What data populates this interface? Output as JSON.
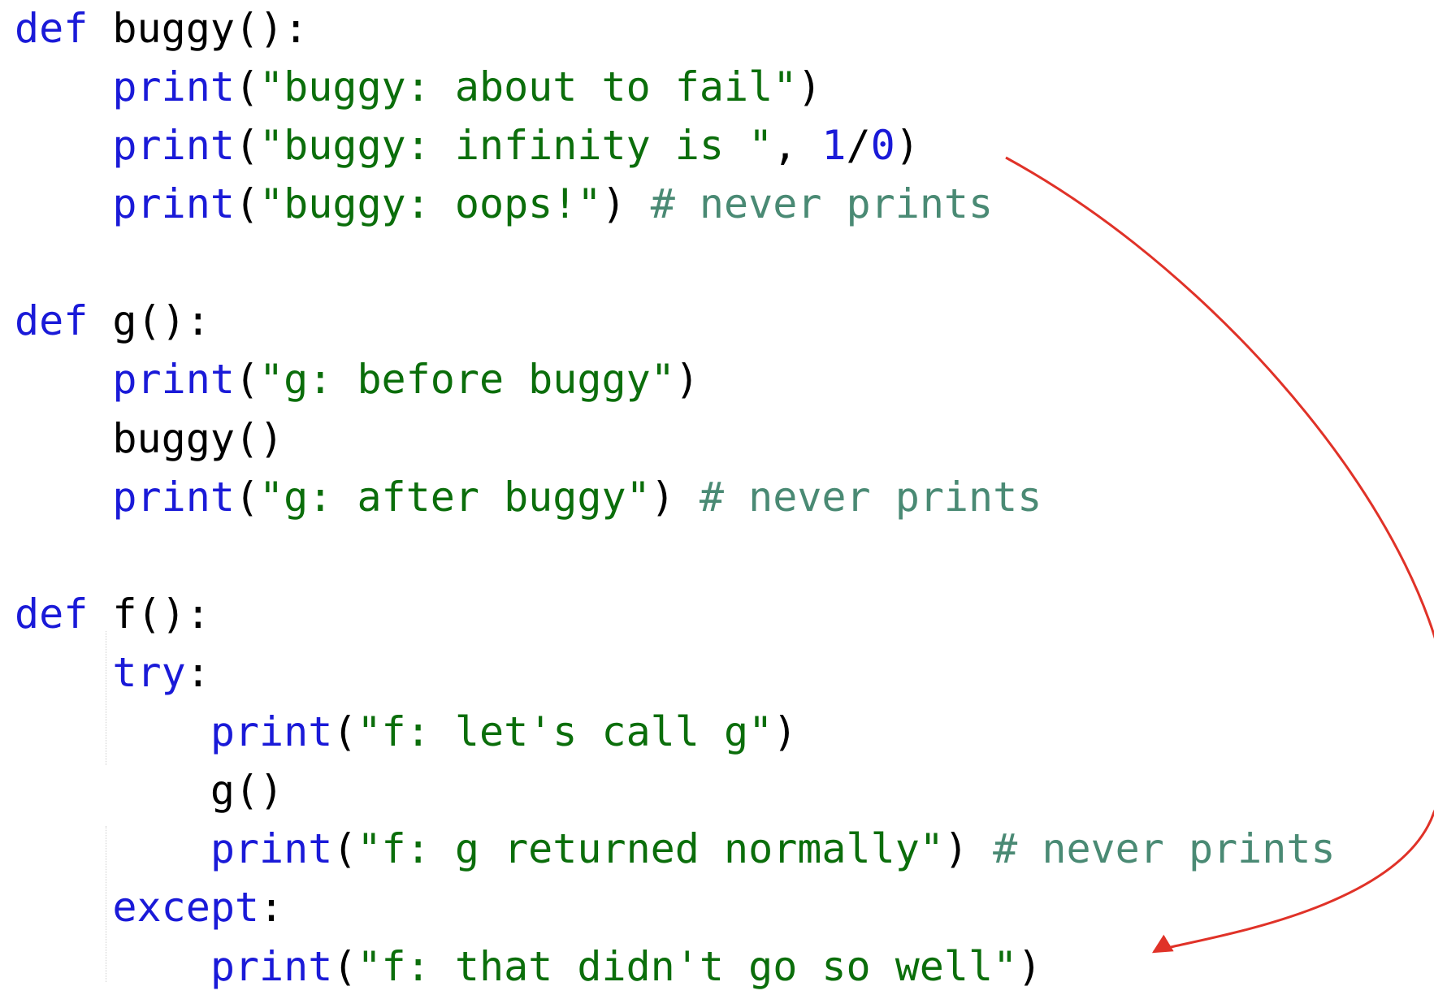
{
  "colors": {
    "background": "#ffffff",
    "keyword": "#1a1ad8",
    "builtin": "#1a1ad8",
    "string": "#0b6e0b",
    "comment": "#4a8a74",
    "number": "#1a1ad8",
    "plain": "#000000",
    "arrow": "#e03228"
  },
  "code": {
    "lines": [
      [
        {
          "t": "def",
          "k": "keyword"
        },
        {
          "t": " buggy():",
          "k": "plain"
        }
      ],
      [
        {
          "t": "    ",
          "k": "plain"
        },
        {
          "t": "print",
          "k": "builtin"
        },
        {
          "t": "(",
          "k": "plain"
        },
        {
          "t": "\"buggy: about to fail\"",
          "k": "string"
        },
        {
          "t": ")",
          "k": "plain"
        }
      ],
      [
        {
          "t": "    ",
          "k": "plain"
        },
        {
          "t": "print",
          "k": "builtin"
        },
        {
          "t": "(",
          "k": "plain"
        },
        {
          "t": "\"buggy: infinity is \"",
          "k": "string"
        },
        {
          "t": ", ",
          "k": "plain"
        },
        {
          "t": "1",
          "k": "number"
        },
        {
          "t": "/",
          "k": "plain"
        },
        {
          "t": "0",
          "k": "number"
        },
        {
          "t": ")",
          "k": "plain"
        }
      ],
      [
        {
          "t": "    ",
          "k": "plain"
        },
        {
          "t": "print",
          "k": "builtin"
        },
        {
          "t": "(",
          "k": "plain"
        },
        {
          "t": "\"buggy: oops!\"",
          "k": "string"
        },
        {
          "t": ") ",
          "k": "plain"
        },
        {
          "t": "# never prints",
          "k": "comment"
        }
      ],
      [],
      [
        {
          "t": "def",
          "k": "keyword"
        },
        {
          "t": " g():",
          "k": "plain"
        }
      ],
      [
        {
          "t": "    ",
          "k": "plain"
        },
        {
          "t": "print",
          "k": "builtin"
        },
        {
          "t": "(",
          "k": "plain"
        },
        {
          "t": "\"g: before buggy\"",
          "k": "string"
        },
        {
          "t": ")",
          "k": "plain"
        }
      ],
      [
        {
          "t": "    buggy()",
          "k": "plain"
        }
      ],
      [
        {
          "t": "    ",
          "k": "plain"
        },
        {
          "t": "print",
          "k": "builtin"
        },
        {
          "t": "(",
          "k": "plain"
        },
        {
          "t": "\"g: after buggy\"",
          "k": "string"
        },
        {
          "t": ") ",
          "k": "plain"
        },
        {
          "t": "# never prints",
          "k": "comment"
        }
      ],
      [],
      [
        {
          "t": "def",
          "k": "keyword"
        },
        {
          "t": " f():",
          "k": "plain"
        }
      ],
      [
        {
          "t": "    ",
          "k": "plain"
        },
        {
          "t": "try",
          "k": "keyword"
        },
        {
          "t": ":",
          "k": "plain"
        }
      ],
      [
        {
          "t": "        ",
          "k": "plain"
        },
        {
          "t": "print",
          "k": "builtin"
        },
        {
          "t": "(",
          "k": "plain"
        },
        {
          "t": "\"f: let's call g\"",
          "k": "string"
        },
        {
          "t": ")",
          "k": "plain"
        }
      ],
      [
        {
          "t": "        g()",
          "k": "plain"
        }
      ],
      [
        {
          "t": "        ",
          "k": "plain"
        },
        {
          "t": "print",
          "k": "builtin"
        },
        {
          "t": "(",
          "k": "plain"
        },
        {
          "t": "\"f: g returned normally\"",
          "k": "string"
        },
        {
          "t": ") ",
          "k": "plain"
        },
        {
          "t": "# never prints",
          "k": "comment"
        }
      ],
      [
        {
          "t": "    ",
          "k": "plain"
        },
        {
          "t": "except",
          "k": "keyword"
        },
        {
          "t": ":",
          "k": "plain"
        }
      ],
      [
        {
          "t": "        ",
          "k": "plain"
        },
        {
          "t": "print",
          "k": "builtin"
        },
        {
          "t": "(",
          "k": "plain"
        },
        {
          "t": "\"f: that didn't go so well\"",
          "k": "string"
        },
        {
          "t": ")",
          "k": "plain"
        }
      ]
    ]
  },
  "annotation": {
    "arrow_from": "buggy: infinity is 1/0 line",
    "arrow_to": "except handler print line"
  }
}
